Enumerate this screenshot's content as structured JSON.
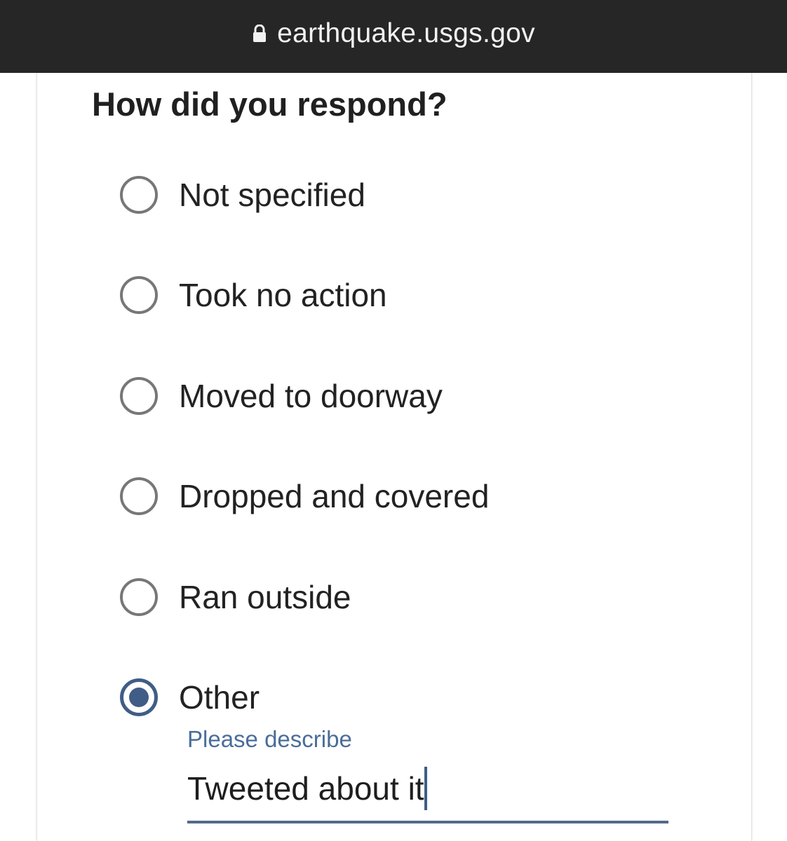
{
  "browser": {
    "url": "earthquake.usgs.gov",
    "lock_icon": "lock-icon"
  },
  "form": {
    "question": "How did you respond?",
    "options": [
      {
        "label": "Not specified",
        "checked": false
      },
      {
        "label": "Took no action",
        "checked": false
      },
      {
        "label": "Moved to doorway",
        "checked": false
      },
      {
        "label": "Dropped and covered",
        "checked": false
      },
      {
        "label": "Ran outside",
        "checked": false
      },
      {
        "label": "Other",
        "checked": true
      }
    ],
    "other_field": {
      "label": "Please describe",
      "value": "Tweeted about it"
    }
  },
  "colors": {
    "topbar_bg": "#262626",
    "accent": "#3f5d86",
    "radio_border": "#777777",
    "field_label": "#4a6d99"
  }
}
